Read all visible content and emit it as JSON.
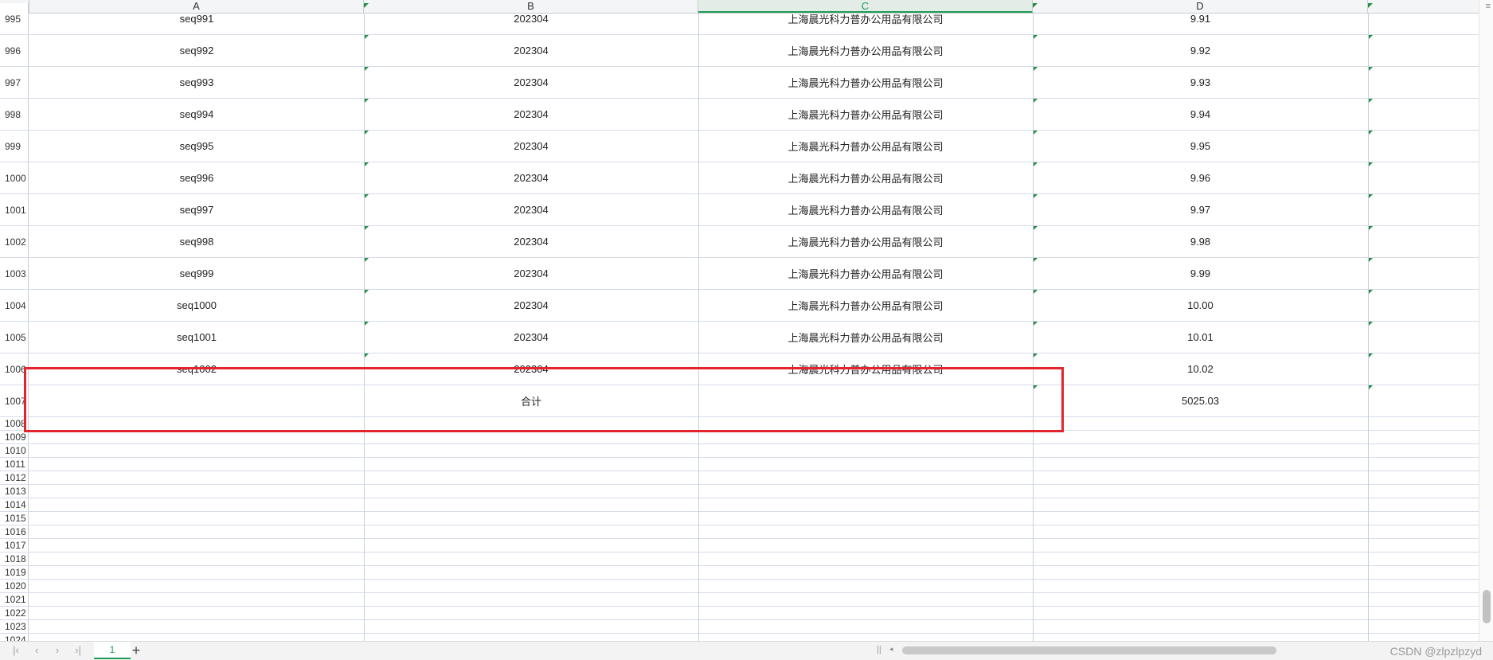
{
  "columns": [
    {
      "letter": "A",
      "active": false
    },
    {
      "letter": "B",
      "active": false
    },
    {
      "letter": "C",
      "active": true
    },
    {
      "letter": "D",
      "active": false
    }
  ],
  "rows": [
    {
      "num": "995",
      "a": "seq991",
      "b": "202304",
      "c": "上海晨光科力普办公用品有限公司",
      "d": "9.91"
    },
    {
      "num": "996",
      "a": "seq992",
      "b": "202304",
      "c": "上海晨光科力普办公用品有限公司",
      "d": "9.92"
    },
    {
      "num": "997",
      "a": "seq993",
      "b": "202304",
      "c": "上海晨光科力普办公用品有限公司",
      "d": "9.93"
    },
    {
      "num": "998",
      "a": "seq994",
      "b": "202304",
      "c": "上海晨光科力普办公用品有限公司",
      "d": "9.94"
    },
    {
      "num": "999",
      "a": "seq995",
      "b": "202304",
      "c": "上海晨光科力普办公用品有限公司",
      "d": "9.95"
    },
    {
      "num": "1000",
      "a": "seq996",
      "b": "202304",
      "c": "上海晨光科力普办公用品有限公司",
      "d": "9.96"
    },
    {
      "num": "1001",
      "a": "seq997",
      "b": "202304",
      "c": "上海晨光科力普办公用品有限公司",
      "d": "9.97"
    },
    {
      "num": "1002",
      "a": "seq998",
      "b": "202304",
      "c": "上海晨光科力普办公用品有限公司",
      "d": "9.98"
    },
    {
      "num": "1003",
      "a": "seq999",
      "b": "202304",
      "c": "上海晨光科力普办公用品有限公司",
      "d": "9.99"
    },
    {
      "num": "1004",
      "a": "seq1000",
      "b": "202304",
      "c": "上海晨光科力普办公用品有限公司",
      "d": "10.00"
    },
    {
      "num": "1005",
      "a": "seq1001",
      "b": "202304",
      "c": "上海晨光科力普办公用品有限公司",
      "d": "10.01"
    },
    {
      "num": "1006",
      "a": "seq1002",
      "b": "202304",
      "c": "上海晨光科力普办公用品有限公司",
      "d": "10.02"
    }
  ],
  "total_row": {
    "num": "1007",
    "label": "合计",
    "value": "5025.03"
  },
  "empty_rows": [
    "1008",
    "1009",
    "1010",
    "1011",
    "1012",
    "1013",
    "1014",
    "1015",
    "1016",
    "1017",
    "1018",
    "1019",
    "1020",
    "1021",
    "1022",
    "1023",
    "1024"
  ],
  "sheet_tabs": [
    {
      "label": "1",
      "active": true
    }
  ],
  "nav_icons": [
    "first-sheet-icon",
    "prev-sheet-icon",
    "next-sheet-icon",
    "last-sheet-icon"
  ],
  "watermark": "CSDN @zlpzlpzyd",
  "colors": {
    "accent": "#1f9d55",
    "highlight": "#e5232b",
    "text_marker": "#1f8f3f"
  }
}
